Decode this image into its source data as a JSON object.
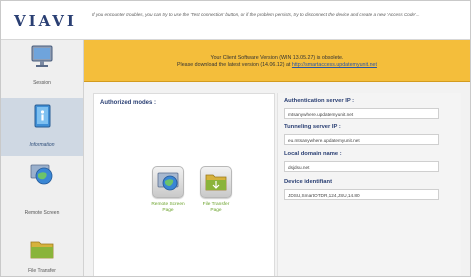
{
  "header": {
    "logo_text": "VIAVI",
    "notice": "If you encounter troubles, you can try to use the 'Test connection' button, or if the problem persists, try to disconnect the device and create a new 'Access Code'..."
  },
  "sidebar": {
    "items": [
      {
        "label": "Session",
        "icon": "monitor-icon"
      },
      {
        "label": "Information",
        "icon": "information-icon"
      },
      {
        "label": "Remote Screen",
        "icon": "globe-icon"
      },
      {
        "label": "File Transfer",
        "icon": "folder-icon"
      }
    ]
  },
  "banner": {
    "line1": "Your Client Software Version (WIN 13.05.27) is obsolete.",
    "line2_prefix": "Please download the latest version (14.06.12) at",
    "line2_link": "http://smartaccess.updatemyunit.net"
  },
  "modes": {
    "title": "Authorized modes :",
    "items": [
      {
        "label_line1": "Remote Screen",
        "label_line2": "Page",
        "icon": "remote-screen-icon"
      },
      {
        "label_line1": "File Transfer",
        "label_line2": "Page",
        "icon": "file-transfer-icon"
      }
    ]
  },
  "fields": [
    {
      "label": "Authentication server IP :",
      "value": "mtsanywhere.updatemyunit.net"
    },
    {
      "label": "Tunneling server IP :",
      "value": "eu.mtsanywhere.updatemyunit.net"
    },
    {
      "label": "Local domain name :",
      "value": "dsjdsu.net"
    },
    {
      "label": "Device identifiant",
      "value": "JDSU,SmartOTDR,124,JSU,14.80"
    }
  ],
  "colors": {
    "banner": "#f4be3b",
    "brand": "#2a3f73",
    "mode_label": "#6aa22a"
  }
}
